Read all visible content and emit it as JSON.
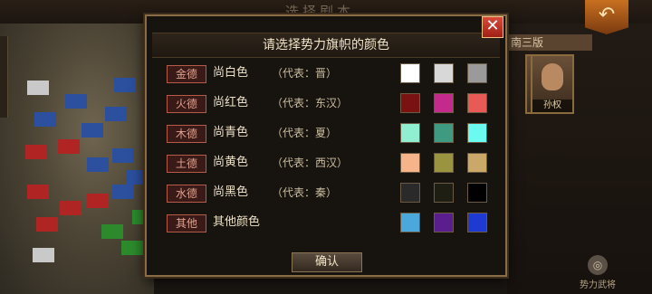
{
  "background": {
    "title": "选择剧本",
    "scenario_label": "南三版",
    "portrait_name": "孙权",
    "back_icon": "back-arrow-icon",
    "force_general_label": "势力武将"
  },
  "dialog": {
    "title": "请选择势力旗帜的颜色",
    "close_label": "✕",
    "confirm_label": "确认",
    "rows": [
      {
        "tag": "金德",
        "desc": "尚白色",
        "rep": "（代表：晋）",
        "colors": [
          "#ffffff",
          "#d8d8d8",
          "#9a9a9a"
        ]
      },
      {
        "tag": "火德",
        "desc": "尚红色",
        "rep": "（代表：东汉）",
        "colors": [
          "#7a1212",
          "#c42a8c",
          "#e85a56"
        ]
      },
      {
        "tag": "木德",
        "desc": "尚青色",
        "rep": "（代表：夏）",
        "colors": [
          "#8fefd0",
          "#3f9a82",
          "#6afaf0"
        ]
      },
      {
        "tag": "土德",
        "desc": "尚黄色",
        "rep": "（代表：西汉）",
        "colors": [
          "#f5b48a",
          "#9a9440",
          "#c9a868"
        ]
      },
      {
        "tag": "水德",
        "desc": "尚黑色",
        "rep": "（代表：秦）",
        "colors": [
          "#2a2a2a",
          "#1e1e12",
          "#000000"
        ]
      },
      {
        "tag": "其他",
        "desc": "其他颜色",
        "rep": "",
        "colors": [
          "#4aa8dc",
          "#5a1e8e",
          "#1e3ad2"
        ]
      }
    ]
  }
}
